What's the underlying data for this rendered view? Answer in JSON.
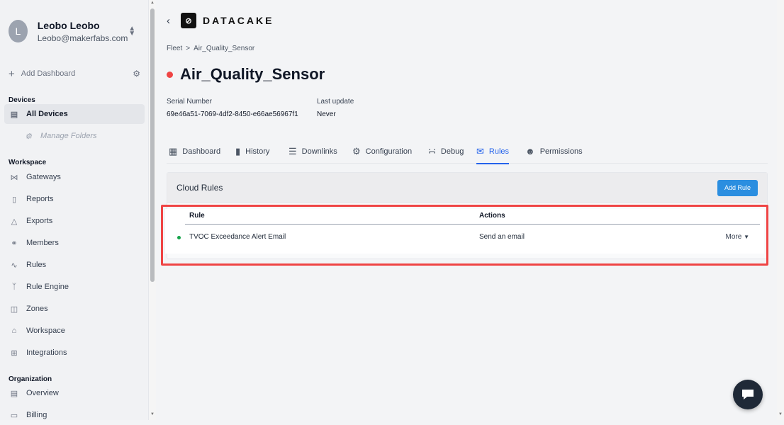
{
  "account": {
    "avatar_letter": "L",
    "name": "Leobo Leobo",
    "email": "Leobo@makerfabs.com"
  },
  "sidebar": {
    "add_dashboard": "Add Dashboard",
    "devices_title": "Devices",
    "all_devices": "All Devices",
    "manage_folders": "Manage Folders",
    "workspace_title": "Workspace",
    "workspace_items": [
      "Gateways",
      "Reports",
      "Exports",
      "Members",
      "Rules",
      "Rule Engine",
      "Zones",
      "Workspace",
      "Integrations"
    ],
    "organization_title": "Organization",
    "organization_items": [
      "Overview",
      "Billing"
    ]
  },
  "header": {
    "logo_text": "DATACAKE"
  },
  "breadcrumb": {
    "fleet": "Fleet",
    "separator": ">",
    "current": "Air_Quality_Sensor"
  },
  "device": {
    "title": "Air_Quality_Sensor",
    "status_color": "#ef4444",
    "serial_label": "Serial Number",
    "serial_value": "69e46a51-7069-4df2-8450-e66ae56967f1",
    "last_update_label": "Last update",
    "last_update_value": "Never"
  },
  "tabs": [
    {
      "label": "Dashboard",
      "icon": "table-icon"
    },
    {
      "label": "History",
      "icon": "bar-chart-icon"
    },
    {
      "label": "Downlinks",
      "icon": "sliders-icon"
    },
    {
      "label": "Configuration",
      "icon": "gear-icon"
    },
    {
      "label": "Debug",
      "icon": "rss-icon"
    },
    {
      "label": "Rules",
      "icon": "chat-bubbles-icon",
      "active": true
    },
    {
      "label": "Permissions",
      "icon": "users-icon"
    }
  ],
  "cloud_rules": {
    "title": "Cloud Rules",
    "add_button": "Add Rule",
    "columns": {
      "rule": "Rule",
      "actions": "Actions"
    },
    "rows": [
      {
        "rule": "TVOC Exceedance Alert Email",
        "action": "Send an email",
        "more": "More",
        "status_color": "#16a34a"
      }
    ]
  },
  "colors": {
    "accent": "#2563eb",
    "highlight": "#ef4444",
    "button": "#2b8ee0"
  }
}
